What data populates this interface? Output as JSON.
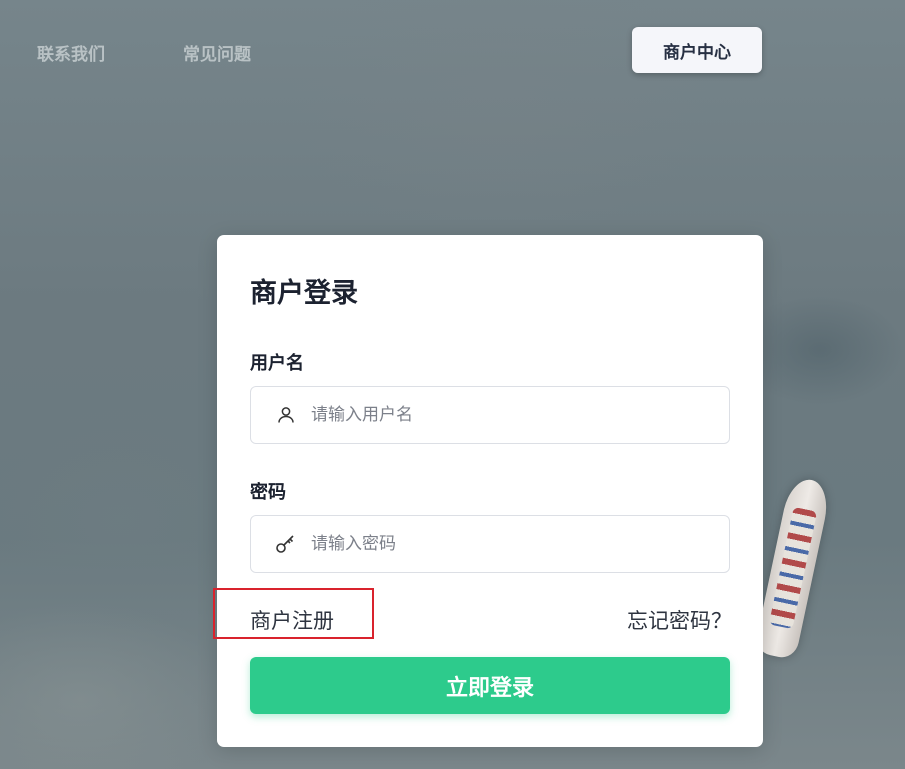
{
  "nav": {
    "contact_label": "联系我们",
    "faq_label": "常见问题",
    "merchant_center_label": "商户中心"
  },
  "login": {
    "title": "商户登录",
    "username_label": "用户名",
    "username_placeholder": "请输入用户名",
    "username_value": "",
    "username_icon": "user-icon",
    "password_label": "密码",
    "password_placeholder": "请输入密码",
    "password_value": "",
    "password_icon": "key-icon",
    "register_label": "商户注册",
    "forgot_label": "忘记密码？",
    "submit_label": "立即登录"
  },
  "colors": {
    "accent": "#2dcb8c",
    "highlight": "#d9232d"
  }
}
